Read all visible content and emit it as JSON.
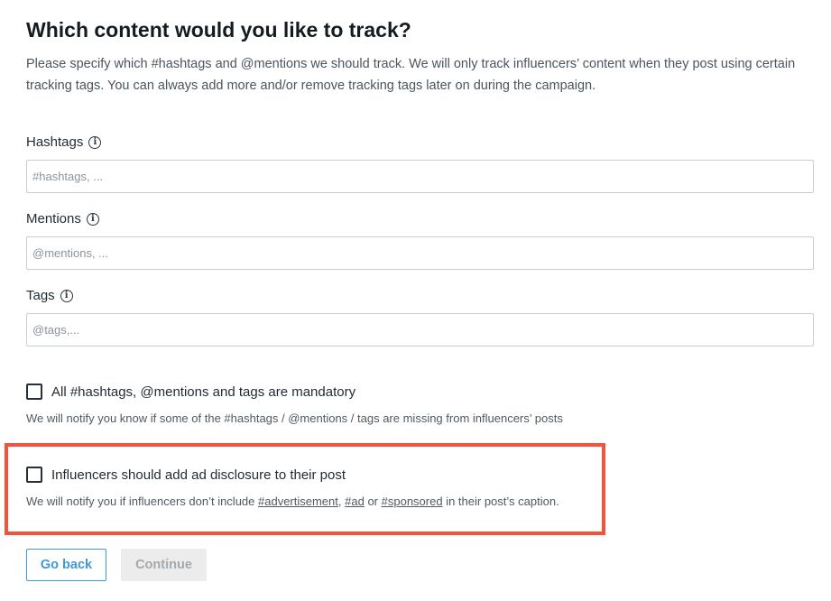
{
  "header": {
    "title": "Which content would you like to track?",
    "intro": "Please specify which #hashtags and @mentions we should track. We will only track influencers’ content when they post using certain tracking tags. You can always add more and/or remove tracking tags later on during the campaign."
  },
  "fields": {
    "hashtags": {
      "label": "Hashtags",
      "placeholder": "#hashtags, ...",
      "value": ""
    },
    "mentions": {
      "label": "Mentions",
      "placeholder": "@mentions, ...",
      "value": ""
    },
    "tags": {
      "label": "Tags",
      "placeholder": "@tags,...",
      "value": ""
    }
  },
  "options": {
    "mandatory": {
      "label": "All #hashtags, @mentions and tags are mandatory",
      "help": "We will notify you know if some of the #hashtags / @mentions / tags are missing from influencers’ posts",
      "checked": false
    },
    "disclosure": {
      "label": "Influencers should add ad disclosure to their post",
      "help_prefix": "We will notify you if influencers don’t include ",
      "tag_advertisement": "#advertisement",
      "sep1": ", ",
      "tag_ad": "#ad",
      "sep2": " or ",
      "tag_sponsored": "#sponsored",
      "help_suffix": " in their post’s caption.",
      "checked": false
    }
  },
  "actions": {
    "back_label": "Go back",
    "continue_label": "Continue"
  },
  "icons": {
    "info": "info-icon"
  },
  "colors": {
    "accent": "#3f9bd0",
    "highlight": "#f4533b",
    "disabled_bg": "#ececec",
    "disabled_text": "#a3a9ad"
  }
}
